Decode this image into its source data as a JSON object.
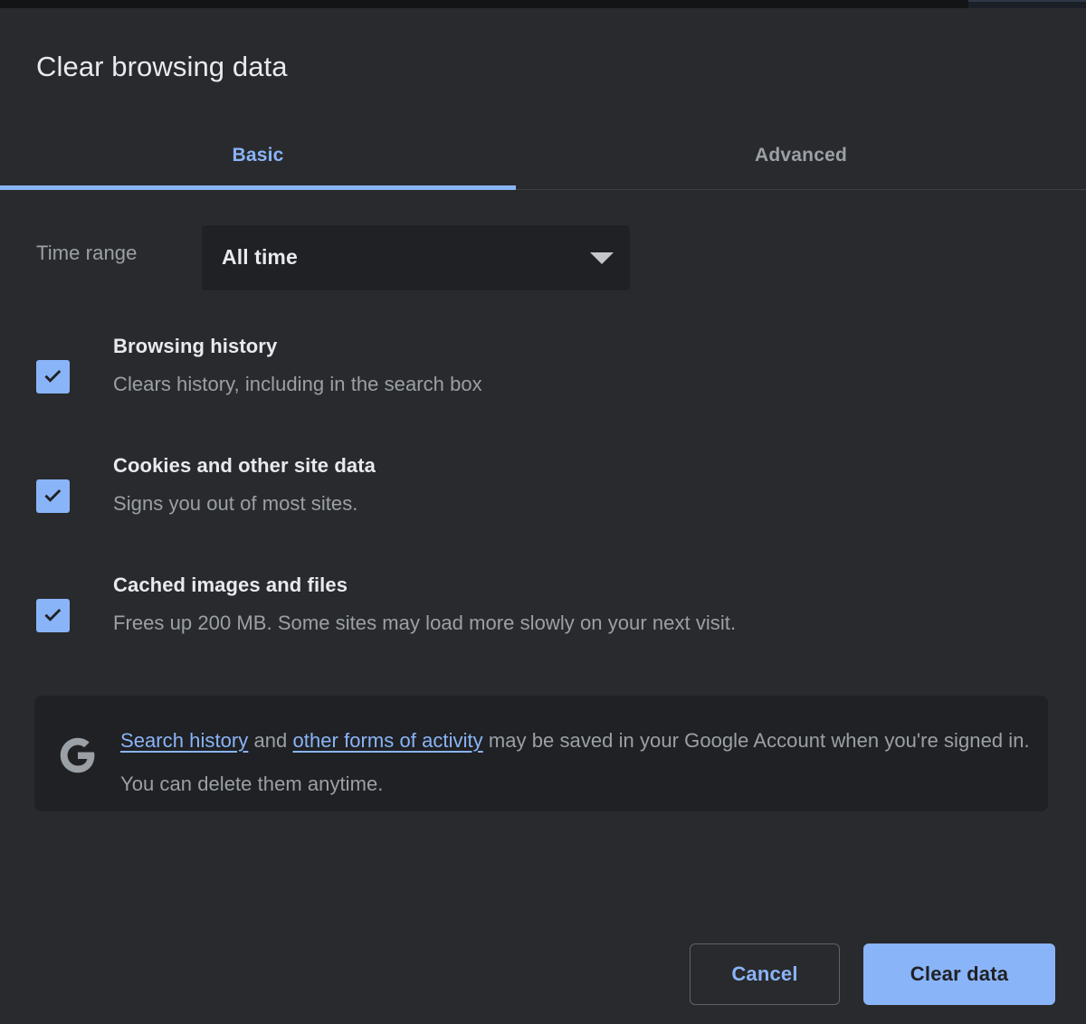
{
  "dialog": {
    "title": "Clear browsing data"
  },
  "tabs": [
    {
      "label": "Basic",
      "selected": true
    },
    {
      "label": "Advanced",
      "selected": false
    }
  ],
  "time_range": {
    "label": "Time range",
    "selected_value": "All time",
    "arrow_icon": "chevron-down-icon"
  },
  "options": [
    {
      "title": "Browsing history",
      "description": "Clears history, including in the search box",
      "checked": true
    },
    {
      "title": "Cookies and other site data",
      "description": "Signs you out of most sites.",
      "checked": true
    },
    {
      "title": "Cached images and files",
      "description": "Frees up 200 MB. Some sites may load more slowly on your next visit.",
      "checked": true
    }
  ],
  "notice": {
    "logo_icon": "google-g-icon",
    "link_1": "Search history",
    "middle_text": " and ",
    "link_2": "other forms of activity",
    "tail_text": " may be saved in your Google Account when you're signed in. You can delete them anytime."
  },
  "footer": {
    "cancel_label": "Cancel",
    "clear_label": "Clear data"
  },
  "colors": {
    "dialog_background": "#292a2d",
    "panel_background": "#202124",
    "accent_blue": "#8ab4f8",
    "primary_text": "#e8eaed",
    "secondary_text": "#9aa0a6",
    "divider": "#3c4043"
  }
}
